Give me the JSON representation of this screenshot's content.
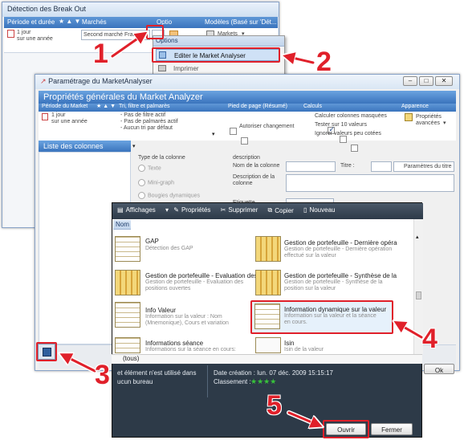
{
  "window1": {
    "title": "Détection des Break Out",
    "col_period": "Période et durée",
    "col_markets": "Marchés",
    "col_options": "Optio",
    "col_models": "Modèles (Basé sur 'Dét...",
    "period_value_1": "1 jour",
    "period_value_2": "sur une année",
    "market_dropdown": "Second marché Françai",
    "models_dropdown": "Markets"
  },
  "menu": {
    "header": "Options",
    "item1": "Editer le Market Analyser",
    "item2": "Imprimer"
  },
  "window2": {
    "title": "Paramétrage du MarketAnalyser",
    "banner": "Propriétés générales du Market Analyzer",
    "sections": {
      "period": "Période du Market",
      "sort": "Tri, filtre et palmarès",
      "footer": "Pied de page (Résumé)",
      "calc": "Calculs",
      "appearance": "Apparence"
    },
    "period_1": "1 jour",
    "period_2": "sur une année",
    "sort_lines": [
      "- Pas de filtre actif",
      "- Pas de palmarès actif",
      "- Aucun tri par défaut"
    ],
    "footer_authorize": "Autoriser changement",
    "calc_1": "Calculer colonnes masquées",
    "calc_2": "Tester sur 10 valeurs",
    "calc_3": "Ignorer valeurs peu cotées",
    "appearance_btn_1": "Propriétés",
    "appearance_btn_2": "avancées",
    "columns_list": "Liste des colonnes",
    "col_type": "Type de la colonne",
    "type_text": "Texte",
    "type_minigraph": "Mini-graph",
    "type_candles": "Bougies dynamiques",
    "description": "description",
    "col_name": "Nom de la colonne",
    "title_label": "Titre :",
    "title_params": "Paramètres du titre",
    "col_description": "Description de la colonne",
    "label": "Etiquette",
    "ok": "Ok"
  },
  "dialog": {
    "toolbar": {
      "display": "Affichages",
      "properties": "Propriétés",
      "delete": "Supprimer",
      "copy": "Copier",
      "new": "Nouveau"
    },
    "nom_header": "Nom",
    "items": [
      {
        "title": "GAP",
        "desc": "Détection des GAP",
        "thumb": "table"
      },
      {
        "title": "Gestion de portefeuille - Dernière opéra",
        "desc": "Gestion de portefeuille - Dernière opération effectué sur la valeur",
        "thumb": "chart"
      },
      {
        "title": "Gestion de portefeuille - Evaluation des",
        "desc": "Gestion de portefeuille - Evaluation des positions ouvertes",
        "thumb": "chart"
      },
      {
        "title": "Gestion de portefeuille - Synthèse de la",
        "desc": "Gestion de portefeuille - Synthèse de la position sur la valeur",
        "thumb": "chart"
      },
      {
        "title": "Info Valeur",
        "desc": "Information sur la valeur : Nom (Mnemonique), Cours et variation",
        "thumb": "table"
      },
      {
        "title": "Information dynamique sur la valeur",
        "desc": "Information sur la valeur et la séance en cours.",
        "thumb": "table"
      },
      {
        "title": "Informations séance",
        "desc": "Informations sur la séance  en cours:",
        "thumb": "table"
      },
      {
        "title": "Isin",
        "desc": "Isin de la valeur",
        "thumb": "ticker"
      }
    ],
    "filter": "(tous)",
    "unused_1": "et élément n'est utilisé dans",
    "unused_2": "ucun bureau",
    "created": "Date création : lun. 07 déc. 2009 15:15:17",
    "ranking": "Classement :",
    "stars": "★★★★",
    "open": "Ouvrir",
    "close": "Fermer"
  },
  "annotations": [
    "1",
    "2",
    "3",
    "4",
    "5"
  ],
  "colors": {
    "annotation": "#e0202a",
    "banner": "#3a74bd",
    "dialog_bg": "#2d3a48"
  }
}
